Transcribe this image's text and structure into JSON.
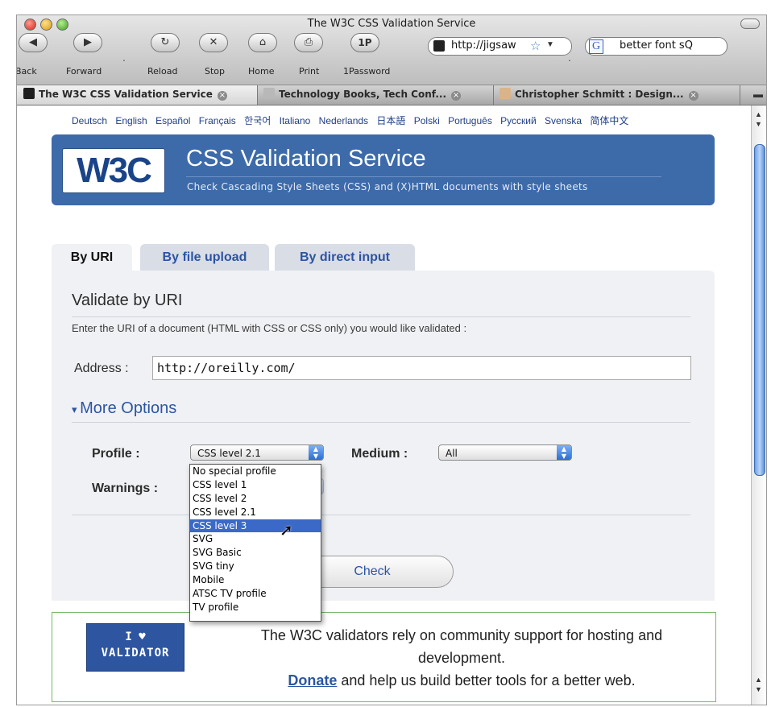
{
  "window": {
    "title": "The W3C CSS Validation Service"
  },
  "toolbar": {
    "buttons": [
      {
        "label": "Back",
        "glyph": "◀"
      },
      {
        "label": "Forward",
        "glyph": "▶"
      },
      {
        "label": "Reload",
        "glyph": "↻"
      },
      {
        "label": "Stop",
        "glyph": "✕"
      },
      {
        "label": "Home",
        "glyph": "⌂"
      },
      {
        "label": "Print",
        "glyph": "⎙"
      },
      {
        "label": "1Password",
        "glyph": "1P"
      }
    ],
    "url": "http://jigsaw",
    "search": "better font sQ"
  },
  "tabs": [
    {
      "label": "The W3C CSS Validation Service"
    },
    {
      "label": "Technology Books, Tech Conf..."
    },
    {
      "label": "Christopher Schmitt : Design..."
    }
  ],
  "languages": [
    "Deutsch",
    "English",
    "Español",
    "Français",
    "한국어",
    "Italiano",
    "Nederlands",
    "日本語",
    "Polski",
    "Português",
    "Русский",
    "Svenska",
    "简体中文"
  ],
  "banner": {
    "logo": "W3C",
    "title": "CSS Validation Service",
    "subtitle": "Check Cascading Style Sheets (CSS) and (X)HTML documents with style sheets"
  },
  "page_tabs": [
    "By URI",
    "By file upload",
    "By direct input"
  ],
  "form": {
    "heading": "Validate by URI",
    "description": "Enter the URI of a document (HTML with CSS or CSS only) you would like validated :",
    "address_label": "Address :",
    "address_value": "http://oreilly.com/",
    "more_options": "More Options",
    "profile_label": "Profile :",
    "profile_value": "CSS level 2.1",
    "medium_label": "Medium :",
    "medium_value": "All",
    "warnings_label": "Warnings :",
    "check_label": "Check"
  },
  "profile_options": [
    "No special profile",
    "CSS level 1",
    "CSS level 2",
    "CSS level 2.1",
    "CSS level 3",
    "SVG",
    "SVG Basic",
    "SVG tiny",
    "Mobile",
    "ATSC TV profile",
    "TV profile"
  ],
  "highlighted_option": "CSS level 3",
  "footer": {
    "badge_line1": "I ♥",
    "badge_line2": "VALIDATOR",
    "text1": "The W3C validators rely on community support for hosting and development.",
    "link": "Donate",
    "text2": " and help us build better tools for a better web."
  }
}
